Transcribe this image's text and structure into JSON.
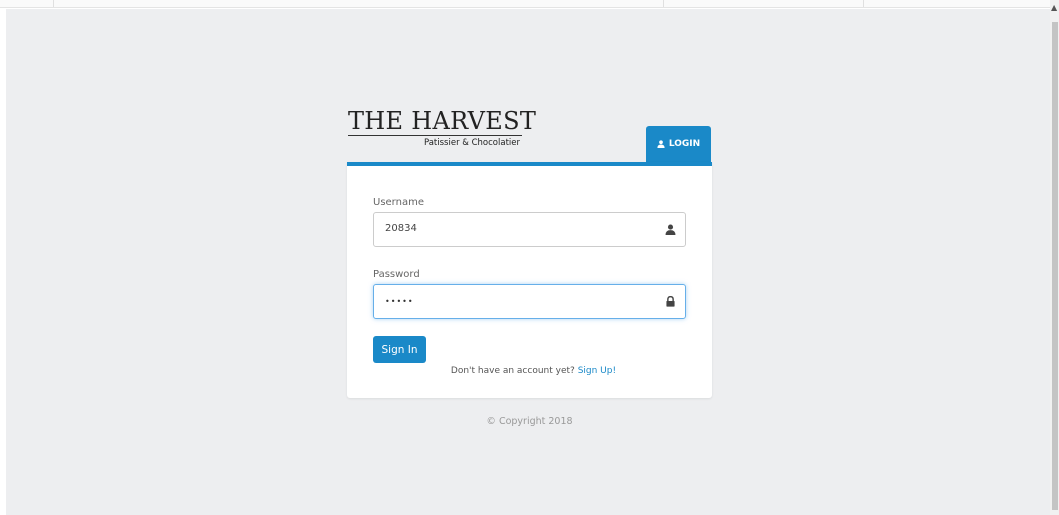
{
  "brand": {
    "name": "THE HARVEST",
    "tagline": "Patissier & Chocolatier"
  },
  "login_tab": {
    "label": "LOGIN",
    "icon": "user-icon"
  },
  "form": {
    "username_label": "Username",
    "username_value": "20834",
    "username_icon": "user-icon",
    "password_label": "Password",
    "password_value": "•••••",
    "password_icon": "lock-icon",
    "signin_label": "Sign In",
    "signup_prompt": "Don't have an account yet?",
    "signup_link": "Sign Up!"
  },
  "footer": {
    "copyright": "© Copyright 2018"
  },
  "colors": {
    "accent": "#1a89c8",
    "background": "#edeef0",
    "focus": "#66afe9"
  }
}
